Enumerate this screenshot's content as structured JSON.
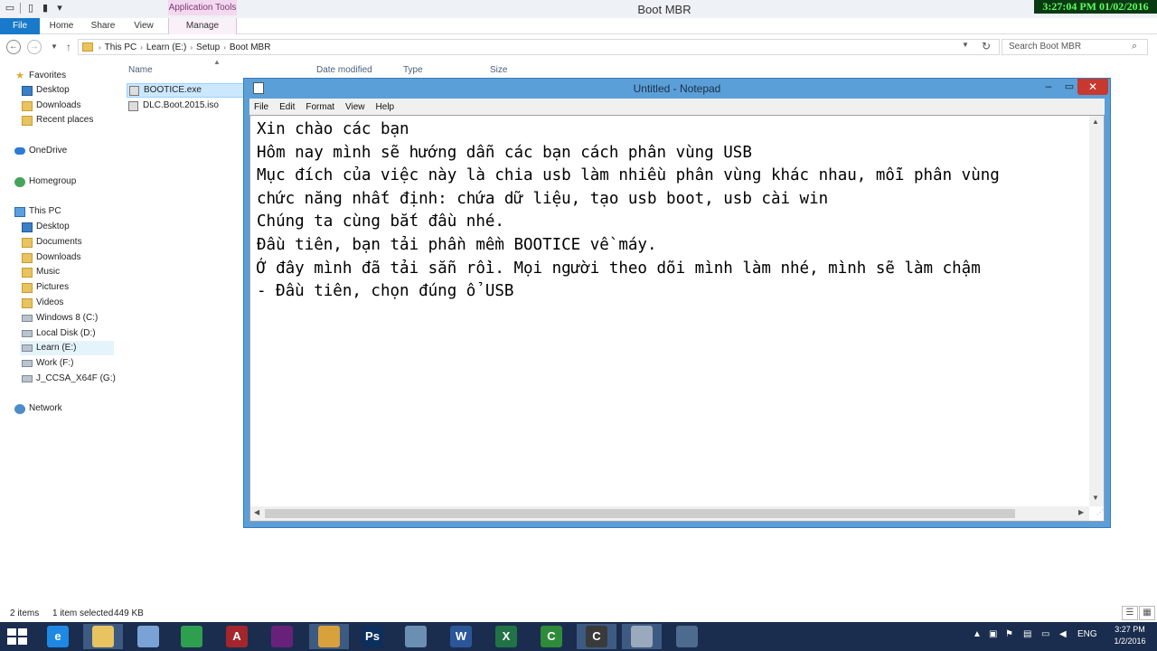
{
  "window": {
    "title": "Boot MBR",
    "context_tab": "Application Tools",
    "clock_overlay": "3:27:04 PM 01/02/2016"
  },
  "ribbon": {
    "tabs": [
      "File",
      "Home",
      "Share",
      "View",
      "Manage"
    ]
  },
  "address": {
    "crumbs": [
      "This PC",
      "Learn (E:)",
      "Setup",
      "Boot MBR"
    ],
    "search_placeholder": "Search Boot MBR"
  },
  "nav": {
    "favorites": "Favorites",
    "fav_items": [
      "Desktop",
      "Downloads",
      "Recent places"
    ],
    "onedrive": "OneDrive",
    "homegroup": "Homegroup",
    "thispc": "This PC",
    "pc_items": [
      "Desktop",
      "Documents",
      "Downloads",
      "Music",
      "Pictures",
      "Videos",
      "Windows 8 (C:)",
      "Local Disk (D:)",
      "Learn (E:)",
      "Work (F:)",
      "J_CCSA_X64F (G:)"
    ],
    "network": "Network"
  },
  "columns": [
    "Name",
    "Date modified",
    "Type",
    "Size"
  ],
  "files": [
    {
      "name": "BOOTICE.exe",
      "selected": true
    },
    {
      "name": "DLC.Boot.2015.iso",
      "selected": false
    }
  ],
  "status": {
    "items": "2 items",
    "selected": "1 item selected",
    "size": "449 KB"
  },
  "notepad": {
    "title": "Untitled - Notepad",
    "menu": [
      "File",
      "Edit",
      "Format",
      "View",
      "Help"
    ],
    "lines": [
      "Xin chào các bạn",
      "Hôm nay mình sẽ hướng dẫn các bạn cách phân vùng USB",
      "Mục đích của việc này là chia usb làm nhiều phân vùng khác nhau, mỗi phân vùng",
      "chức năng nhất định: chứa dữ liệu, tạo usb boot, usb cài win",
      "Chúng ta cùng bắt đầu nhé.",
      "Đầu tiên, bạn tải phần mềm BOOTICE về máy.",
      "Ở đây mình đã tải sẵn rồi. Mọi người theo dõi mình làm nhé, mình sẽ làm chậm",
      "- Đầu tiên, chọn đúng ổ USB"
    ]
  },
  "taskbar": {
    "apps": [
      {
        "name": "internet-explorer",
        "glyph": "e",
        "color": "#1e88e5"
      },
      {
        "name": "file-explorer",
        "glyph": "",
        "color": "#e8c35f"
      },
      {
        "name": "remote-desktop",
        "glyph": "",
        "color": "#7aa2d6"
      },
      {
        "name": "store",
        "glyph": "",
        "color": "#2e9e4f"
      },
      {
        "name": "access",
        "glyph": "A",
        "color": "#a4262c"
      },
      {
        "name": "visual-studio",
        "glyph": "",
        "color": "#68217a"
      },
      {
        "name": "chrome",
        "glyph": "",
        "color": "#d9a13b"
      },
      {
        "name": "photoshop",
        "glyph": "Ps",
        "color": "#0c2f5b"
      },
      {
        "name": "tool",
        "glyph": "",
        "color": "#6b8fb3"
      },
      {
        "name": "word",
        "glyph": "W",
        "color": "#2b579a"
      },
      {
        "name": "excel",
        "glyph": "X",
        "color": "#217346"
      },
      {
        "name": "camtasia",
        "glyph": "C",
        "color": "#2e8b3a"
      },
      {
        "name": "camtasia-recorder",
        "glyph": "C",
        "color": "#3a3a3a"
      },
      {
        "name": "notepad",
        "glyph": "",
        "color": "#9aa9bc"
      },
      {
        "name": "misc",
        "glyph": "",
        "color": "#4d6a8f"
      }
    ],
    "lang": "ENG",
    "time": "3:27 PM",
    "date": "1/2/2016"
  }
}
